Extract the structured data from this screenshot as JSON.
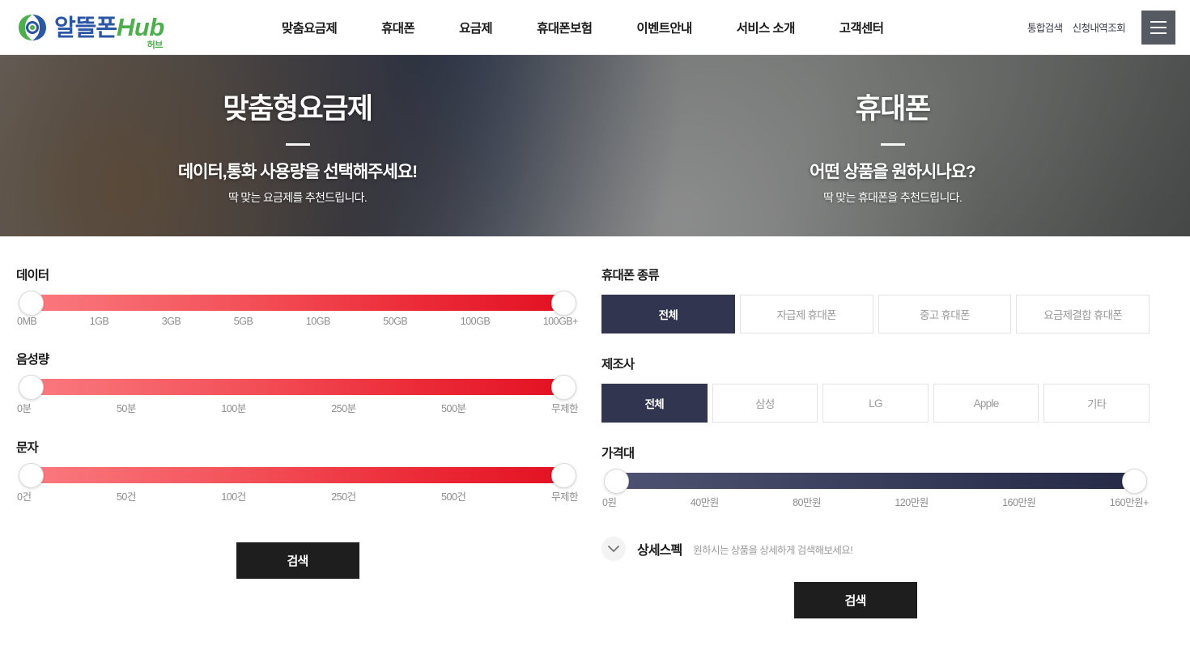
{
  "header": {
    "logo": {
      "kr": "알뜰폰",
      "en": "Hub",
      "sub": "허브",
      "mark_icon": "swirl-logo-icon"
    },
    "nav": [
      {
        "label": "맞춤요금제"
      },
      {
        "label": "휴대폰"
      },
      {
        "label": "요금제"
      },
      {
        "label": "휴대폰보험"
      },
      {
        "label": "이벤트안내"
      },
      {
        "label": "서비스 소개"
      },
      {
        "label": "고객센터"
      }
    ],
    "util": [
      {
        "label": "통합검색"
      },
      {
        "label": "신청내역조회"
      }
    ],
    "menu_icon": "hamburger-menu-icon"
  },
  "hero": {
    "left": {
      "title": "맞춤형요금제",
      "lead": "데이터,통화 사용량을 선택해주세요!",
      "sub": "딱 맞는 요금제를 추천드립니다."
    },
    "right": {
      "title": "휴대폰",
      "lead": "어떤 상품을 원하시나요?",
      "sub": "딱 맞는 휴대폰을 추천드립니다."
    }
  },
  "plan_panel": {
    "sliders": [
      {
        "label": "데이터",
        "ticks": [
          "0MB",
          "1GB",
          "3GB",
          "5GB",
          "10GB",
          "50GB",
          "100GB",
          "100GB+"
        ],
        "min_value": "0MB",
        "max_value": "100GB+",
        "color": "#ec2b38"
      },
      {
        "label": "음성량",
        "ticks": [
          "0분",
          "50분",
          "100분",
          "250분",
          "500분",
          "무제한"
        ],
        "min_value": "0분",
        "max_value": "무제한",
        "color": "#ec2b38"
      },
      {
        "label": "문자",
        "ticks": [
          "0건",
          "50건",
          "100건",
          "250건",
          "500건",
          "무제한"
        ],
        "min_value": "0건",
        "max_value": "무제한",
        "color": "#ec2b38"
      }
    ],
    "search_label": "검색"
  },
  "phone_panel": {
    "phone_type": {
      "label": "휴대폰 종류",
      "options": [
        {
          "label": "전체",
          "active": true
        },
        {
          "label": "자급제 휴대폰",
          "active": false
        },
        {
          "label": "중고 휴대폰",
          "active": false
        },
        {
          "label": "요금제결합 휴대폰",
          "active": false
        }
      ]
    },
    "manufacturer": {
      "label": "제조사",
      "options": [
        {
          "label": "전체",
          "active": true
        },
        {
          "label": "삼성",
          "active": false
        },
        {
          "label": "LG",
          "active": false
        },
        {
          "label": "Apple",
          "active": false
        },
        {
          "label": "기타",
          "active": false
        }
      ]
    },
    "price": {
      "label": "가격대",
      "ticks": [
        "0원",
        "40만원",
        "80만원",
        "120만원",
        "160만원",
        "160만원+"
      ],
      "min_value": "0원",
      "max_value": "160만원+",
      "color": "#2e3350"
    },
    "spec": {
      "icon": "chevron-down-icon",
      "title": "상세스펙",
      "hint": "원하시는 상품을 상세하게 검색해보세요!"
    },
    "search_label": "검색"
  },
  "colors": {
    "accent_red": "#ec2b38",
    "accent_navy": "#32354f",
    "logo_blue": "#2b55a5",
    "logo_green": "#4cae4c",
    "button_black": "#1e1e1e"
  }
}
